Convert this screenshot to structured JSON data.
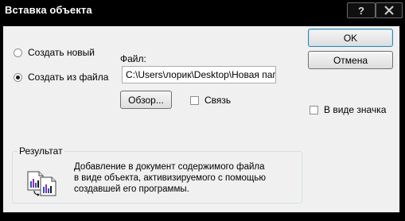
{
  "window": {
    "title": "Вставка объекта",
    "help_glyph": "?"
  },
  "options": {
    "create_new": "Создать новый",
    "create_from_file": "Создать из файла",
    "selected": "create_from_file"
  },
  "file": {
    "label": "Файл:",
    "value": "C:\\Users\\лорик\\Desktop\\Новая папка"
  },
  "buttons": {
    "ok": "OK",
    "cancel": "Отмена",
    "browse": "Обзор..."
  },
  "checkboxes": {
    "link": {
      "label": "Связь",
      "checked": false
    },
    "as_icon": {
      "label": "В виде значка",
      "checked": false
    }
  },
  "result": {
    "legend": "Результат",
    "lines": [
      "Добавление в документ содержимого файла",
      "в виде объекта, активизируемого с помощью",
      "создавшей его программы."
    ],
    "icon": "embedded-object-icon"
  },
  "colors": {
    "titlebar": "#000000",
    "dialog_bg": "#f0f0f0",
    "default_button_border": "#3c7fb1"
  }
}
